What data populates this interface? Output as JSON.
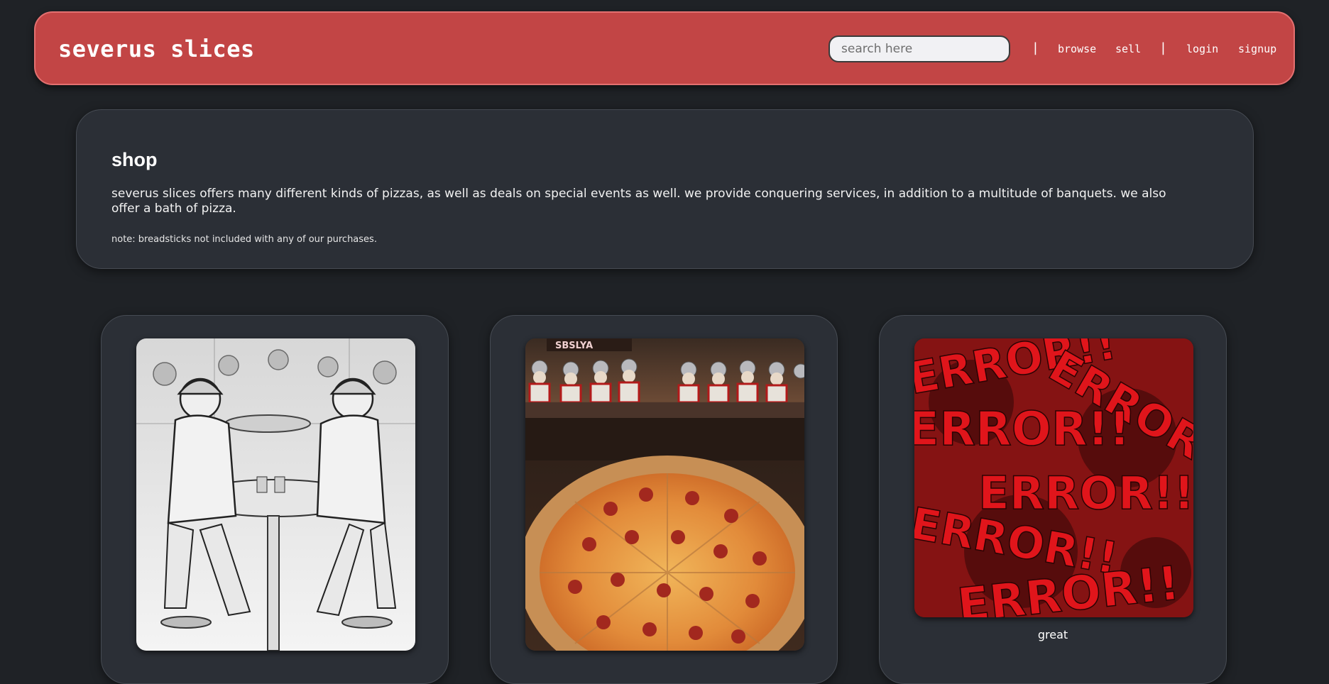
{
  "header": {
    "brand": "severus slices",
    "search_placeholder": "search here",
    "separator": "|",
    "nav": {
      "browse": "browse",
      "sell": "sell",
      "login": "login",
      "signup": "signup"
    }
  },
  "intro": {
    "title": "shop",
    "description": "severus slices offers many different kinds of pizzas, as well as deals on special events as well. we provide conquering services, in addition to a multitude of banquets. we also offer a bath of pizza.",
    "note": "note: breadsticks not included with any of our purchases."
  },
  "products": [
    {
      "image": "roman-soldiers-sketch-eating-pizza"
    },
    {
      "image": "pepperoni-pizza-with-roman-soldiers",
      "sign_text": "SBSLYA"
    },
    {
      "image": "error-graphic",
      "error_text": "ERROR!!",
      "caption": "great"
    }
  ],
  "colors": {
    "background": "#1f2226",
    "header": "#c24545",
    "header_border": "#e37070",
    "panel": "#2b2f36",
    "panel_border": "#464b53",
    "error_red": "#e0151b"
  }
}
